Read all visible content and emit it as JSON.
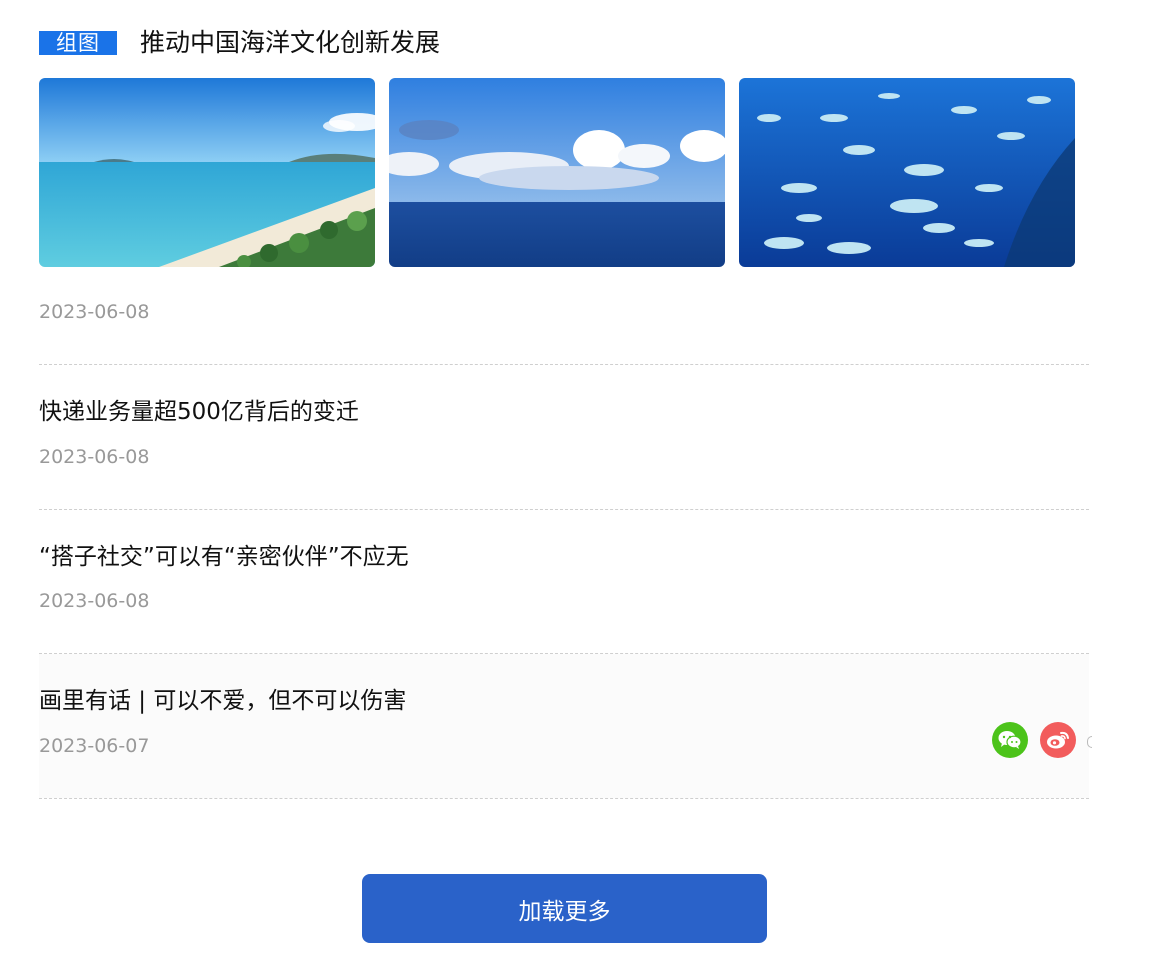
{
  "gallery": {
    "tag": "组图",
    "title": "推动中国海洋文化创新发展",
    "date": "2023-06-08"
  },
  "articles": [
    {
      "title": "快递业务量超500亿背后的变迁",
      "date": "2023-06-08"
    },
    {
      "title": "“搭子社交”可以有“亲密伙伴”不应无",
      "date": "2023-06-08"
    },
    {
      "title": "画里有话 | 可以不爱，但不可以伤害",
      "date": "2023-06-07"
    }
  ],
  "share": {
    "wechat_icon": "wechat-icon",
    "weibo_icon": "weibo-icon"
  },
  "load_more_label": "加载更多",
  "colors": {
    "tag_bg": "#1a73e8",
    "button_bg": "#2a62c9",
    "wechat": "#4cc31a",
    "weibo": "#f25c5c"
  }
}
